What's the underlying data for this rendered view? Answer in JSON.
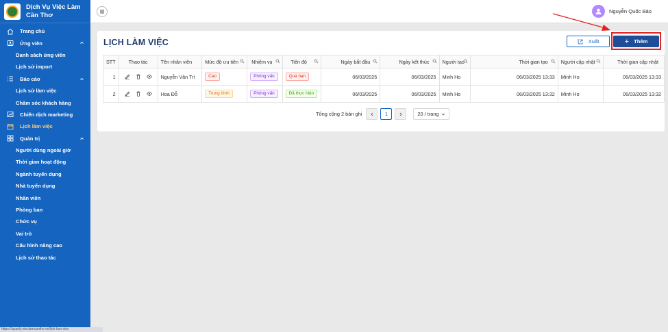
{
  "app": {
    "title": "Dịch Vụ Việc Làm Cần Thơ"
  },
  "sidebar": {
    "items": [
      {
        "label": "Trang chủ",
        "icon": "home-icon",
        "level": 0
      },
      {
        "label": "Ứng viên",
        "icon": "user-icon",
        "level": 0,
        "expanded": true
      },
      {
        "label": "Danh sách ứng viên",
        "level": 1
      },
      {
        "label": "Lịch sử import",
        "level": 1
      },
      {
        "label": "Báo cáo",
        "icon": "list-icon",
        "level": 0,
        "expanded": true
      },
      {
        "label": "Lịch sử làm việc",
        "level": 1
      },
      {
        "label": "Chăm sóc khách hàng",
        "level": 1
      },
      {
        "label": "Chiến dịch marketing",
        "icon": "chart-icon",
        "level": 0
      },
      {
        "label": "Lịch làm việc",
        "icon": "calendar-icon",
        "level": 0,
        "active": true
      },
      {
        "label": "Quản trị",
        "icon": "admin-icon",
        "level": 0,
        "expanded": true
      },
      {
        "label": "Người dùng ngoài giờ",
        "level": 1
      },
      {
        "label": "Thời gian hoạt động",
        "level": 1
      },
      {
        "label": "Ngành tuyển dụng",
        "level": 1
      },
      {
        "label": "Nhà tuyển dụng",
        "level": 1
      },
      {
        "label": "Nhân viên",
        "level": 1
      },
      {
        "label": "Phòng ban",
        "level": 1
      },
      {
        "label": "Chức vụ",
        "level": 1
      },
      {
        "label": "Vai trò",
        "level": 1
      },
      {
        "label": "Cấu hình nâng cao",
        "level": 1
      },
      {
        "label": "Lịch sử thao tác",
        "level": 1
      }
    ]
  },
  "status_url": "https://quanly.vieclamcantho.vn/lich-lam-viec",
  "header": {
    "user_name": "Nguyễn Quốc Bảo"
  },
  "page": {
    "title": "LỊCH LÀM VIỆC",
    "export_label": "Xuất",
    "add_label": "Thêm"
  },
  "table": {
    "columns": [
      "STT",
      "Thao tác",
      "Tên nhân viên",
      "Mức độ ưu tiên",
      "Nhiệm vụ",
      "Tiến độ",
      "Ngày bắt đầu",
      "Ngày kết thúc",
      "Người tạo",
      "Thời gian tạo",
      "Người cập nhật",
      "Thời gian cập nhật"
    ],
    "rows": [
      {
        "stt": "1",
        "employee": "Nguyễn Văn Trí",
        "priority": "Cao",
        "priority_color": "#d4380d",
        "task": "Phỏng vấn",
        "progress": "Quá hạn",
        "progress_color": "#d4380d",
        "start": "06/03/2025",
        "end": "06/03/2025",
        "creator": "Minh Ho",
        "created_at": "06/03/2025 13:33",
        "updater": "Minh Ho",
        "updated_at": "06/03/2025 13:33"
      },
      {
        "stt": "2",
        "employee": "Hoa Đỗ",
        "priority": "Trung bình",
        "priority_color": "#d46b08",
        "task": "Phỏng vấn",
        "progress": "Đã thực hiện",
        "progress_color": "#389e0d",
        "start": "06/03/2025",
        "end": "06/03/2025",
        "creator": "Minh Ho",
        "created_at": "06/03/2025 13:32",
        "updater": "Minh Ho",
        "updated_at": "06/03/2025 13:32"
      }
    ]
  },
  "pagination": {
    "total_text": "Tổng cộng 2 bản ghi",
    "current_page": "1",
    "page_size": "20 / trang"
  },
  "colors": {
    "sidebar_bg": "#1565c0",
    "primary": "#1e4e9a",
    "active_nav": "#ffcc80",
    "highlight": "#e52222"
  }
}
